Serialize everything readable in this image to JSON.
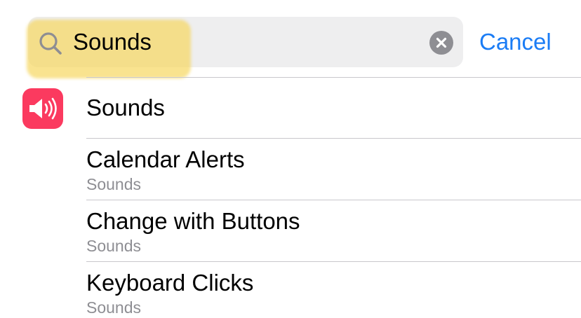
{
  "search": {
    "query": "Sounds",
    "clear_icon": "clear-icon",
    "search_icon": "magnifying-glass-icon",
    "cancel_label": "Cancel"
  },
  "colors": {
    "accent": "#1a7cf5",
    "sounds_icon_bg": "#fb3a5f",
    "highlight": "#f6d65a",
    "secondary_text": "#8e8e93"
  },
  "results": [
    {
      "title": "Sounds",
      "subtitle": "",
      "icon": "speaker-icon"
    },
    {
      "title": "Calendar Alerts",
      "subtitle": "Sounds"
    },
    {
      "title": "Change with Buttons",
      "subtitle": "Sounds"
    },
    {
      "title": "Keyboard Clicks",
      "subtitle": "Sounds"
    }
  ]
}
